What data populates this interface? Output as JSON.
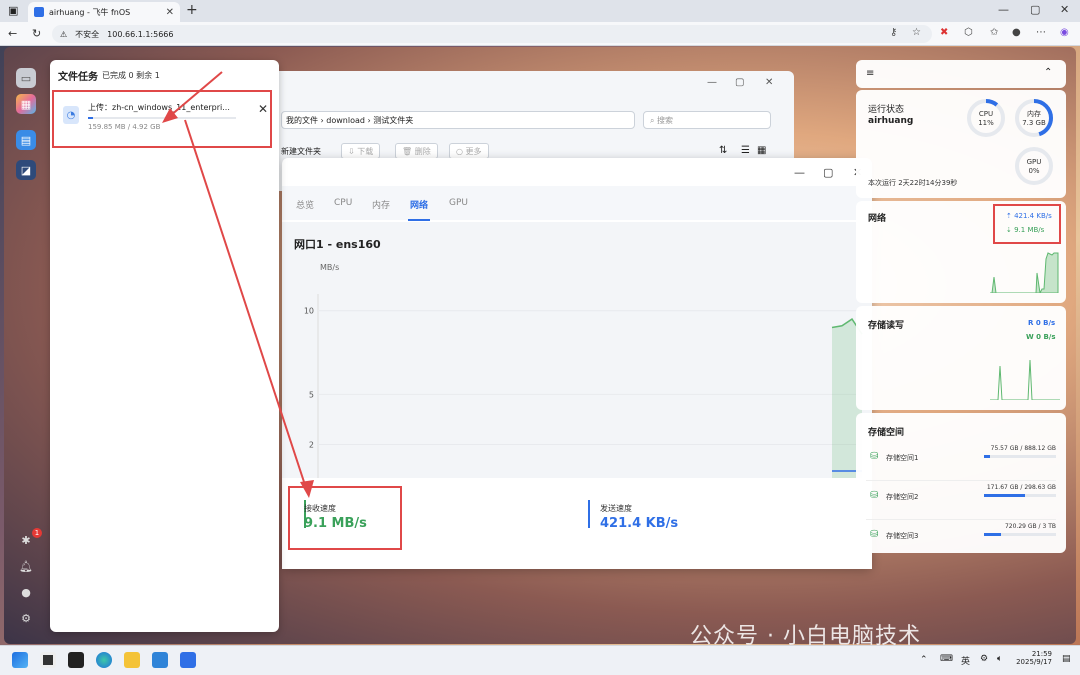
{
  "browser": {
    "tab_title": "airhuang - 飞牛 fnOS",
    "url_security": "不安全",
    "url": "100.66.1.1:5666"
  },
  "task_panel": {
    "title": "文件任务",
    "subtitle": "已完成 0 剩余 1",
    "item": {
      "name": "上传：zh-cn_windows_11_enterpri...",
      "size": "159.85 MB / 4.92 GB",
      "progress": 0.032
    }
  },
  "file_manager": {
    "path": "我的文件 › download › 测试文件夹",
    "search_placeholder": "搜索",
    "new_folder": "新建文件夹",
    "download": "下载",
    "delete": "删除",
    "more": "更多"
  },
  "monitor": {
    "tabs": [
      "总览",
      "CPU",
      "内存",
      "网络",
      "GPU"
    ],
    "active_tab": 3,
    "iface_title": "网口1 - ens160",
    "unit": "MB/s",
    "recv_label": "接收速度",
    "recv_value": "9.1 MB/s",
    "send_label": "发送速度",
    "send_value": "421.4 KB/s"
  },
  "chart_data": {
    "type": "area",
    "yticks": [
      "10",
      "5",
      "2"
    ],
    "ylabel": "MB/s",
    "series": [
      {
        "name": "接收速度",
        "color": "#5fb870",
        "values": [
          0,
          0,
          0,
          0,
          0,
          0,
          0,
          0,
          0,
          0,
          0,
          0,
          0,
          0,
          0,
          0,
          0,
          0,
          0,
          0,
          9.0,
          9.1,
          9.5,
          8.6
        ]
      },
      {
        "name": "发送速度",
        "color": "#2f6fe6",
        "values": [
          0,
          0,
          0,
          0,
          0,
          0,
          0,
          0,
          0,
          0,
          0,
          0,
          0,
          0,
          0,
          0,
          0,
          0,
          0,
          0,
          0.42,
          0.42,
          0.42,
          0.42
        ]
      }
    ]
  },
  "widgets": {
    "status": {
      "title": "运行状态",
      "host": "airhuang",
      "cpu_label": "CPU",
      "cpu_value": "11%",
      "cpu_pct": 0.11,
      "mem_label": "内存",
      "mem_value": "7.3 GB",
      "mem_pct": 0.45,
      "gpu_label": "GPU",
      "gpu_value": "0%",
      "uptime": "本次运行 2天22时14分39秒"
    },
    "network": {
      "title": "网络",
      "up": "421.4 KB/s",
      "down": "9.1 MB/s"
    },
    "disk_io": {
      "title": "存储读写",
      "read": "R 0 B/s",
      "write": "W 0 B/s"
    },
    "storage": {
      "title": "存储空间",
      "items": [
        {
          "name": "存储空间1",
          "usage": "75.57 GB / 888.12 GB",
          "pct": 0.085
        },
        {
          "name": "存储空间2",
          "usage": "171.67 GB / 298.63 GB",
          "pct": 0.575
        },
        {
          "name": "存储空间3",
          "usage": "720.29 GB / 3 TB",
          "pct": 0.23
        }
      ]
    }
  },
  "taskbar": {
    "time": "21:59",
    "date": "2025/9/17",
    "ime": "英"
  },
  "dock": {
    "notification_count": "1"
  },
  "watermark": "公众号 · 小白电脑技术"
}
